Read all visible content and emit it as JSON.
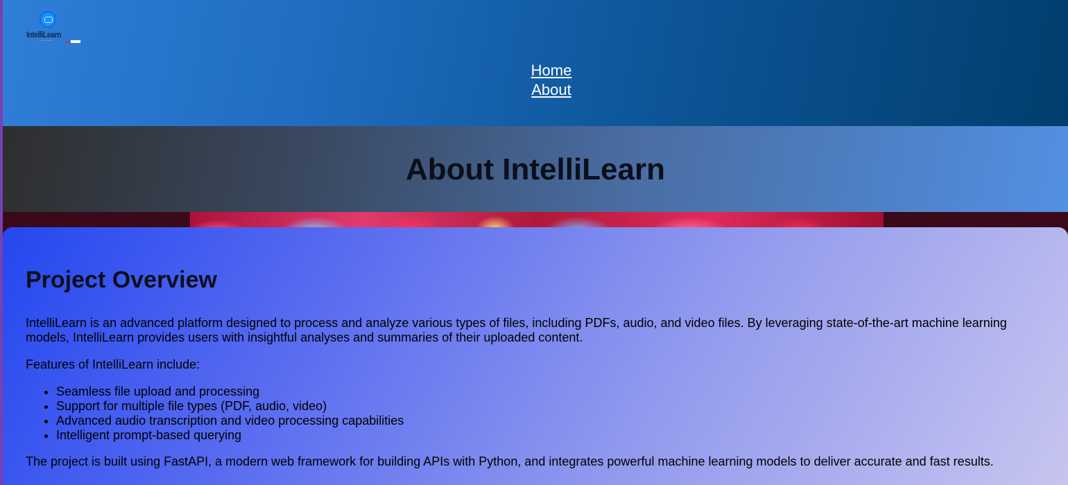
{
  "header": {
    "logo": {
      "text": "IntelliLearn"
    },
    "nav": [
      {
        "label": "Home"
      },
      {
        "label": "About"
      }
    ]
  },
  "hero": {
    "title": "About IntelliLearn"
  },
  "content": {
    "heading": "Project Overview",
    "intro": "IntelliLearn is an advanced platform designed to process and analyze various types of files, including PDFs, audio, and video files. By leveraging state-of-the-art machine learning models, IntelliLearn provides users with insightful analyses and summaries of their uploaded content.",
    "features_intro": "Features of IntelliLearn include:",
    "features": [
      "Seamless file upload and processing",
      "Support for multiple file types (PDF, audio, video)",
      "Advanced audio transcription and video processing capabilities",
      "Intelligent prompt-based querying"
    ],
    "closing": "The project is built using FastAPI, a modern web framework for building APIs with Python, and integrates powerful machine learning models to deliver accurate and fast results."
  },
  "colors": {
    "header_start": "#2f7ed8",
    "header_end": "#013e6e",
    "card_start": "#2447ef",
    "card_end": "#c8c6ef"
  }
}
